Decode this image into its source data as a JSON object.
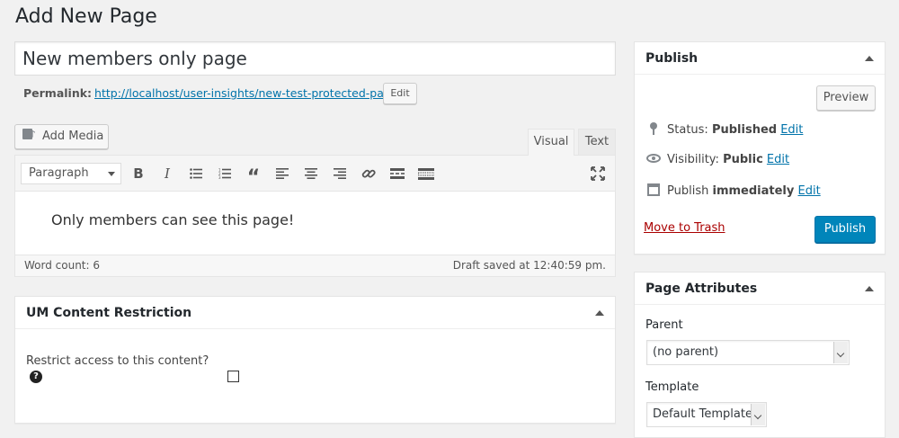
{
  "page": {
    "title": "Add New Page"
  },
  "post": {
    "title": "New members only page"
  },
  "permalink": {
    "label": "Permalink:",
    "url": "http://localhost/user-insights/new-test-protected-page/",
    "edit_label": "Edit"
  },
  "media": {
    "add_label": "Add Media"
  },
  "editor": {
    "tabs": {
      "visual": "Visual",
      "text": "Text"
    },
    "format_select": "Paragraph",
    "toolbar_icons": [
      "bold-icon",
      "italic-icon",
      "bulleted-list-icon",
      "numbered-list-icon",
      "blockquote-icon",
      "align-left-icon",
      "align-center-icon",
      "align-right-icon",
      "link-icon",
      "read-more-icon",
      "toolbar-toggle-icon",
      "fullscreen-icon"
    ],
    "content": "Only members can see this page!",
    "word_count": "Word count: 6",
    "draft_saved": "Draft saved at 12:40:59 pm."
  },
  "um_restriction": {
    "title": "UM Content Restriction",
    "question": "Restrict access to this content?",
    "checked": false
  },
  "publish_box": {
    "title": "Publish",
    "preview_label": "Preview",
    "status_label": "Status:",
    "status_value": "Published",
    "visibility_label": "Visibility:",
    "visibility_value": "Public",
    "publish_label": "Publish",
    "publish_value": "immediately",
    "edit_label": "Edit",
    "trash_label": "Move to Trash",
    "publish_button": "Publish"
  },
  "page_attributes": {
    "title": "Page Attributes",
    "parent_label": "Parent",
    "parent_value": "(no parent)",
    "template_label": "Template",
    "template_value": "Default Template"
  },
  "colors": {
    "primary": "#0085ba",
    "link": "#0073aa",
    "trash": "#aa0000"
  }
}
